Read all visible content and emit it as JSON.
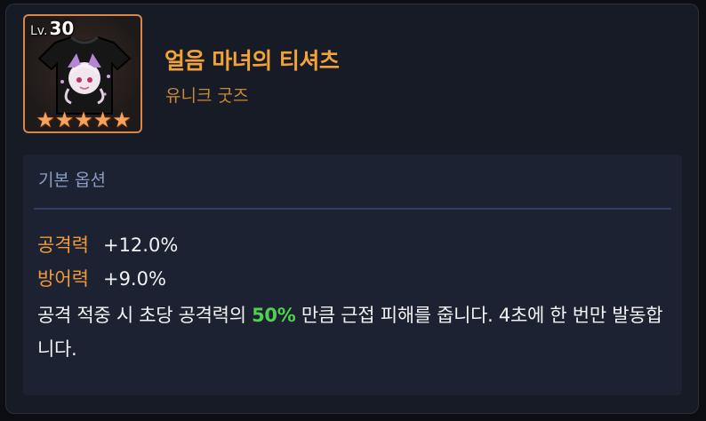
{
  "item": {
    "level_prefix": "Lv.",
    "level": "30",
    "name": "얼음 마녀의 티셔츠",
    "grade": "유니크 굿즈",
    "stars": [
      "★",
      "★",
      "★",
      "★",
      "★"
    ]
  },
  "options": {
    "title": "기본 옵션",
    "stats": [
      {
        "name": "공격력",
        "value": "+12.0%"
      },
      {
        "name": "방어력",
        "value": "+9.0%"
      }
    ],
    "description": {
      "before": "공격 적중 시 초당 공격력의 ",
      "highlight": "50%",
      "after": " 만큼 근접 피해를 줍니다. 4초에 한 번만 발동합니다."
    }
  },
  "colors": {
    "item_name": "#f1a239",
    "grade": "#c88a33",
    "stat_name": "#f19a3a",
    "highlight": "#4fd04f",
    "frame_border": "#d8854a"
  }
}
